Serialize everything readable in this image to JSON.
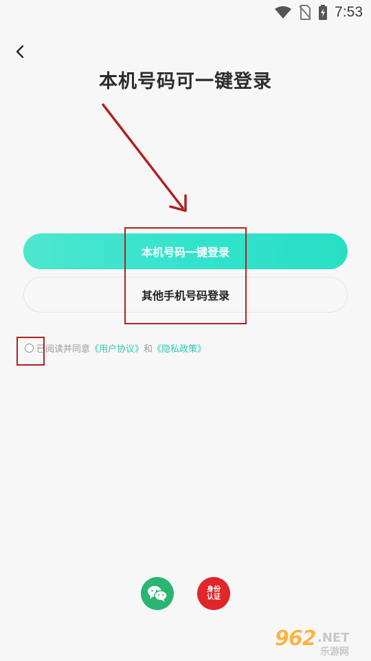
{
  "status_bar": {
    "time": "7:53"
  },
  "page": {
    "title": "本机号码可一键登录"
  },
  "buttons": {
    "one_click_login": "本机号码一键登录",
    "other_phone_login": "其他手机号码登录"
  },
  "agreement": {
    "prefix": "已阅读并同意",
    "user_agreement": "《用户协议》",
    "and": "和",
    "privacy_policy": "《隐私政策》"
  },
  "social": {
    "wechat_icon": "wechat-icon",
    "id_auth_label": "身份认证"
  },
  "watermark": {
    "number": "962",
    "suffix": ".NET",
    "site": "乐游网"
  },
  "colors": {
    "accent": "#34e3cc",
    "link": "#2fc7b2",
    "annotation": "#b22020",
    "wechat": "#2bb570",
    "id_auth": "#e2252a"
  }
}
